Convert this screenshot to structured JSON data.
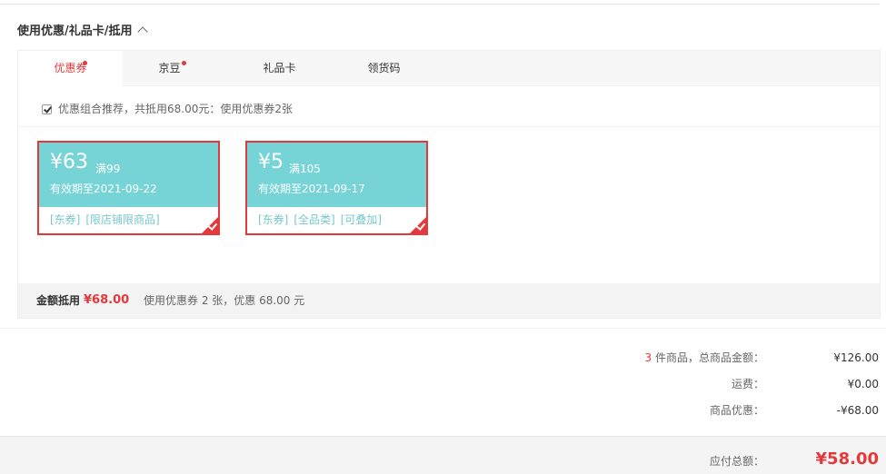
{
  "section": {
    "title": "使用优惠/礼品卡/抵用"
  },
  "tabs": [
    {
      "label": "优惠券",
      "dot": true
    },
    {
      "label": "京豆",
      "dot": true
    },
    {
      "label": "礼品卡",
      "dot": false
    },
    {
      "label": "领货码",
      "dot": false
    }
  ],
  "recommend": {
    "checked": true,
    "text": "优惠组合推荐，共抵用68.00元：使用优惠券2张"
  },
  "coupons": [
    {
      "amount": "¥63",
      "condition": "满99",
      "validity": "有效期至2021-09-22",
      "tags": [
        "[东券]",
        "[限店铺限商品]"
      ],
      "selected": true
    },
    {
      "amount": "¥5",
      "condition": "满105",
      "validity": "有效期至2021-09-17",
      "tags": [
        "[东券]",
        "[全品类]",
        "[可叠加]"
      ],
      "selected": true
    }
  ],
  "discount_summary": {
    "label": "金额抵用",
    "amount": "¥68.00",
    "text": "使用优惠券 2 张，优惠 68.00 元"
  },
  "order": {
    "count": "3",
    "count_suffix": " 件商品，总商品金额：",
    "goods_total": "¥126.00",
    "shipping_label": "运费：",
    "shipping": "¥0.00",
    "discount_label": "商品优惠：",
    "discount": "-¥68.00",
    "payable_label": "应付总额：",
    "payable": "¥58.00"
  },
  "colors": {
    "accent": "#e4393c",
    "coupon": "#76d4d7"
  }
}
